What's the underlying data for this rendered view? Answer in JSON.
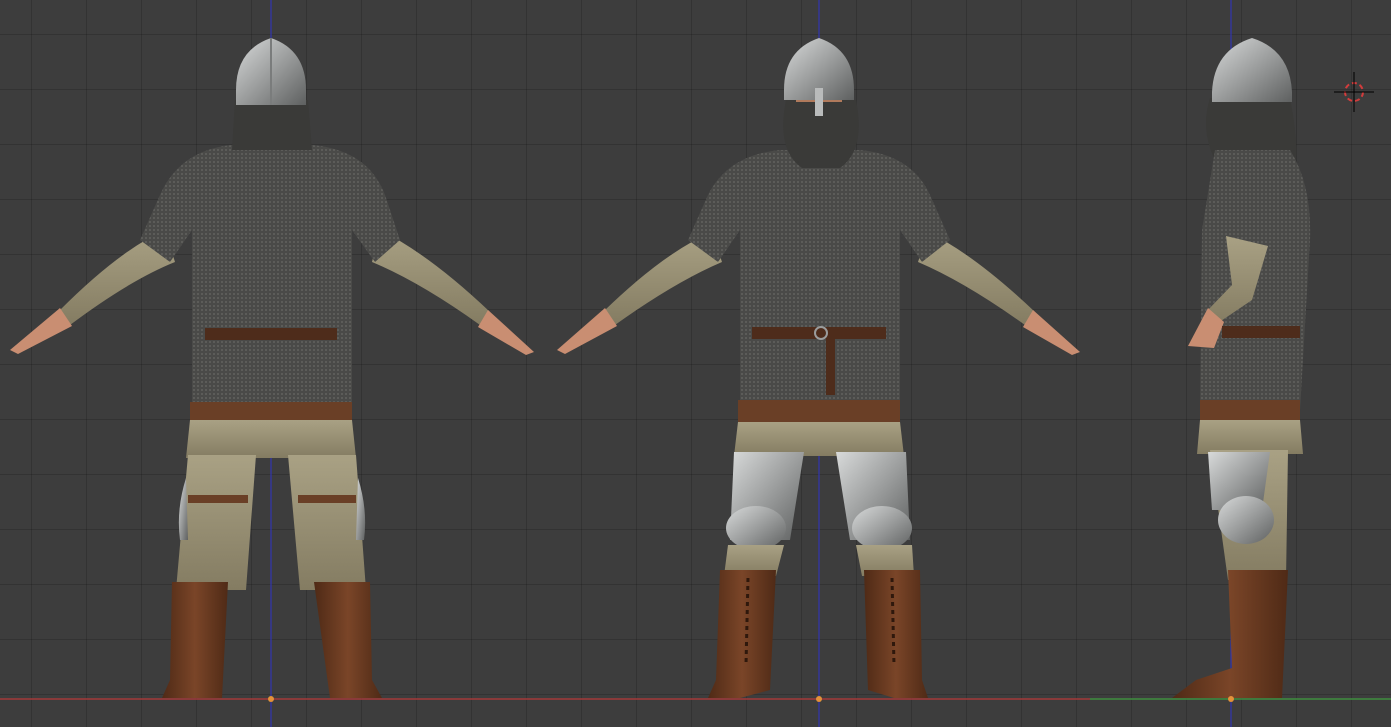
{
  "viewport": {
    "background": "#3d3d3d",
    "axis_vertical_color": "#2f34c8",
    "axis_x_color": "#a33a3a",
    "axis_y_color": "#3f8f3f",
    "origin_color": "#e3923a",
    "cursor_color": "#ffffff",
    "cursor_ring_color": "#d23c3c"
  },
  "views": [
    {
      "id": "back",
      "name": "back-view"
    },
    {
      "id": "front",
      "name": "front-view"
    },
    {
      "id": "side",
      "name": "side-view"
    }
  ],
  "palette": {
    "mail": "#4a4a48",
    "mail_dark": "#2f2f2e",
    "linen": "#9e9678",
    "linen_dark": "#7d765d",
    "leather": "#6a3f26",
    "belt": "#4e2c1b",
    "boot": "#6b3b22",
    "steel": "#a8aaa9",
    "steel_dark": "#6e7070",
    "skin": "#c98e72"
  }
}
